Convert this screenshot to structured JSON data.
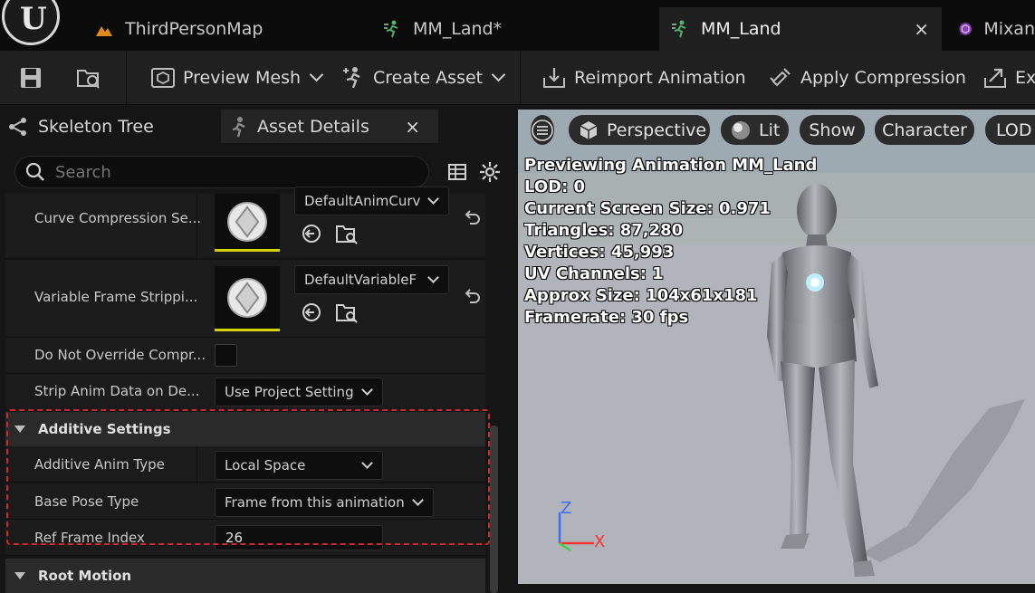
{
  "tabs": [
    {
      "label": "ThirdPersonMap",
      "icon": "level-icon"
    },
    {
      "label": "MM_Land*",
      "icon": "animation-icon"
    },
    {
      "label": "MM_Land",
      "icon": "animation-icon",
      "active": true,
      "close": "×"
    },
    {
      "label": "Mixan",
      "icon": "asset-icon"
    }
  ],
  "toolbar": {
    "preview_mesh": "Preview Mesh",
    "create_asset": "Create Asset",
    "reimport": "Reimport Animation",
    "apply_compression": "Apply Compression",
    "export": "Ex"
  },
  "panel_tabs": {
    "skeleton_tree": "Skeleton Tree",
    "asset_details": "Asset Details",
    "close": "×"
  },
  "search": {
    "placeholder": "Search"
  },
  "properties": {
    "curve_compression": {
      "label": "Curve Compression Se...",
      "value": "DefaultAnimCurv"
    },
    "variable_frame": {
      "label": "Variable Frame Strippi...",
      "value": "DefaultVariableF"
    },
    "do_not_override": {
      "label": "Do Not Override Compr..."
    },
    "strip_anim": {
      "label": "Strip Anim Data on De...",
      "value": "Use Project Setting"
    }
  },
  "additive": {
    "title": "Additive Settings",
    "anim_type_label": "Additive Anim Type",
    "anim_type_value": "Local Space",
    "base_pose_label": "Base Pose Type",
    "base_pose_value": "Frame from this animation",
    "ref_frame_label": "Ref Frame Index",
    "ref_frame_value": "26"
  },
  "root_motion": {
    "title": "Root Motion"
  },
  "viewport": {
    "perspective": "Perspective",
    "lit": "Lit",
    "show": "Show",
    "character": "Character",
    "lod": "LOD",
    "stats": [
      "Previewing Animation MM_Land",
      "LOD: 0",
      "Current Screen Size: 0.971",
      "Triangles: 87,280",
      "Vertices: 45,993",
      "UV Channels: 1",
      "Approx Size: 104x61x181",
      "Framerate: 30 fps"
    ],
    "axis_z": "Z",
    "axis_x": "X"
  },
  "colors": {
    "highlight_dash": "#d0272d",
    "thumb_underline": "#d4d400",
    "axis_z": "#3a6cff",
    "axis_x": "#ff3030",
    "axis_y": "#3ad13a"
  }
}
